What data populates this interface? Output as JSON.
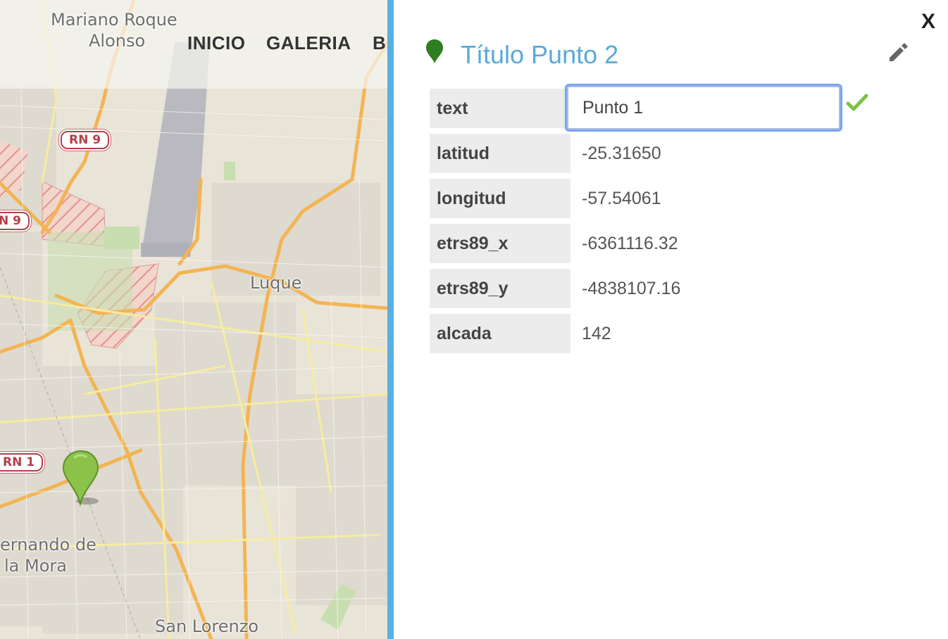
{
  "nav": {
    "items": [
      "INICIO",
      "GALERIA",
      "B"
    ]
  },
  "map": {
    "places": [
      "Mariano Roque",
      "Alonso",
      "Luque",
      "ernando de",
      "la Mora",
      "San Lorenzo"
    ],
    "route_shields": [
      "RN 9",
      "N 9",
      "RN 1"
    ]
  },
  "panel": {
    "close_label": "X",
    "title": "Título Punto 2",
    "fields": [
      {
        "key": "text",
        "value": "Punto 1",
        "editing": true
      },
      {
        "key": "latitud",
        "value": "-25.31650"
      },
      {
        "key": "longitud",
        "value": "-57.54061"
      },
      {
        "key": "etrs89_x",
        "value": "-6361116.32"
      },
      {
        "key": "etrs89_y",
        "value": "-4838107.16"
      },
      {
        "key": "alcada",
        "value": "142"
      }
    ]
  },
  "colors": {
    "title": "#5aaad8",
    "divider": "#5aafe0",
    "pin_dark": "#2e7d1e",
    "marker": "#8bc34a",
    "confirm": "#7cc243",
    "key_bg": "#ececec"
  },
  "icons": {
    "title_pin": "map-pin-icon",
    "edit": "pencil-icon",
    "confirm": "check-icon",
    "close": "close-icon",
    "marker": "map-marker-icon"
  }
}
